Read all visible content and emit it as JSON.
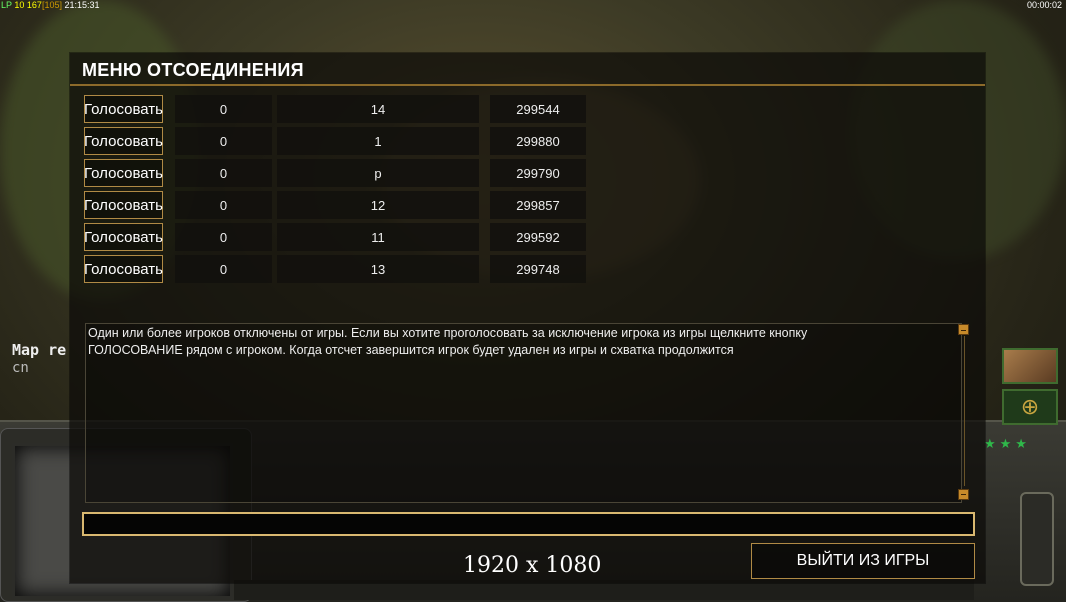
{
  "hud": {
    "top_left_a": "LP",
    "top_left_b": "10",
    "top_left_c": "167",
    "top_left_d": "[105]",
    "top_left_time": "21:15:31",
    "top_right_time": "00:00:02"
  },
  "chat_overlay": {
    "line1": "Map re",
    "line2": "cn"
  },
  "modal": {
    "title": "МЕНЮ ОТСОЕДИНЕНИЯ",
    "rows": [
      {
        "vote": "Голосовать",
        "votes": "0",
        "player": "14",
        "ping": "299544"
      },
      {
        "vote": "Голосовать",
        "votes": "0",
        "player": "1",
        "ping": "299880"
      },
      {
        "vote": "Голосовать",
        "votes": "0",
        "player": "p",
        "ping": "299790"
      },
      {
        "vote": "Голосовать",
        "votes": "0",
        "player": "12",
        "ping": "299857"
      },
      {
        "vote": "Голосовать",
        "votes": "0",
        "player": "11",
        "ping": "299592"
      },
      {
        "vote": "Голосовать",
        "votes": "0",
        "player": "13",
        "ping": "299748"
      }
    ],
    "message_line1": "Один или более игроков отключены от игры. Если вы хотите проголосовать за исключение игрока из игры щелкните кнопку",
    "message_line2": "ГОЛОСОВАНИЕ рядом с игроком. Когда отсчет завершится игрок будет удален из игры и схватка продолжится",
    "chat_input_value": "",
    "quit_label": "ВЫЙТИ ИЗ ИГРЫ"
  },
  "resolution_label": "1920 x 1080",
  "colors": {
    "accent_border": "#b08a45",
    "input_border": "#d9b870",
    "title_rule": "#8c6a2a"
  }
}
